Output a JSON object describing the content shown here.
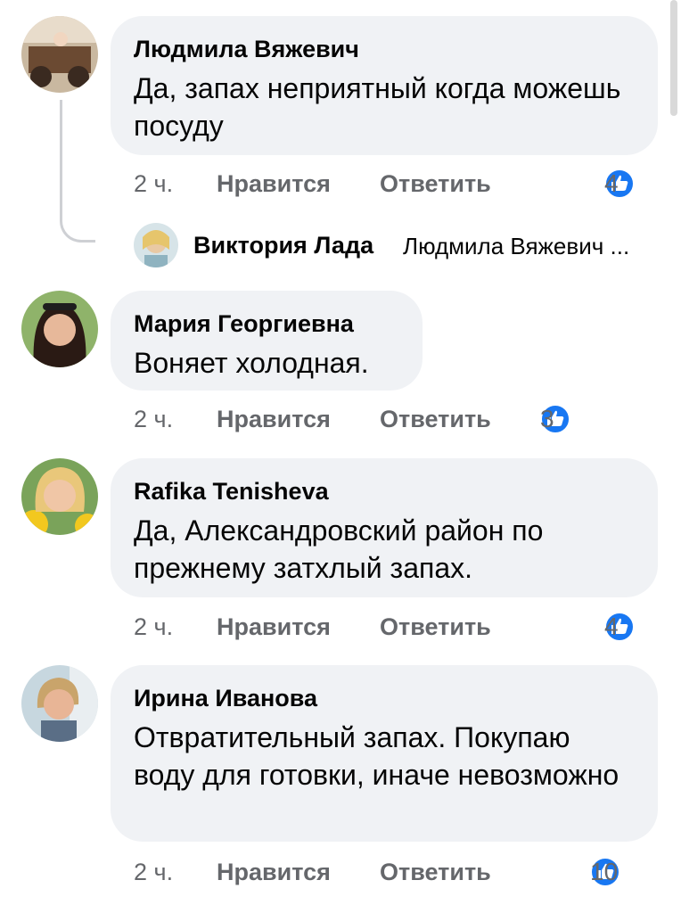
{
  "comments": [
    {
      "author": "Людмила Вяжевич",
      "text": "Да, запах неприятный когда можешь посуду",
      "time": "2 ч.",
      "like_label": "Нравится",
      "reply_label": "Ответить",
      "reactions": "4",
      "reply_preview": {
        "author": "Виктория Лада",
        "text": "Людмила Вяжевич ..."
      }
    },
    {
      "author": "Мария Георгиевна",
      "text": "Воняет холодная.",
      "time": "2 ч.",
      "like_label": "Нравится",
      "reply_label": "Ответить",
      "reactions": "3"
    },
    {
      "author": "Rafika Tenisheva",
      "text": "Да, Александровский район по прежнему затхлый запах.",
      "time": "2 ч.",
      "like_label": "Нравится",
      "reply_label": "Ответить",
      "reactions": "4"
    },
    {
      "author": "Ирина Иванова",
      "text": "Отвратительный запах. Покупаю воду для готовки, иначе невозможно",
      "time": "2 ч.",
      "like_label": "Нравится",
      "reply_label": "Ответить",
      "reactions": "10"
    }
  ],
  "colors": {
    "bubble": "#f0f2f5",
    "meta_text": "#65676b",
    "like_blue": "#1877f2"
  },
  "icons": {
    "reaction": "like-icon"
  }
}
